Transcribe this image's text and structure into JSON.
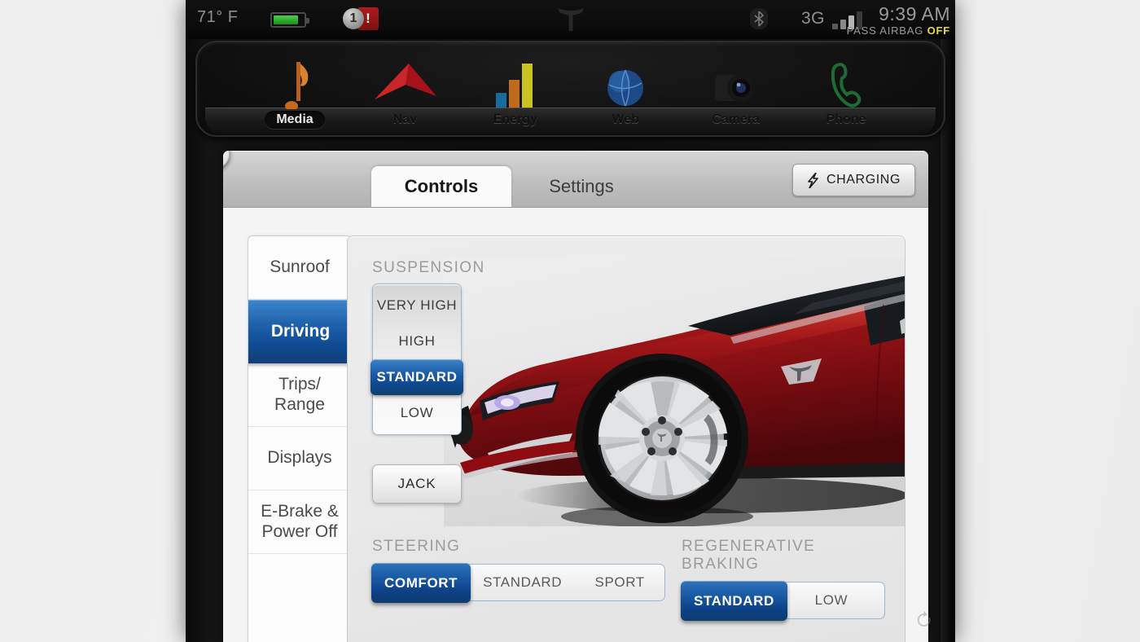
{
  "status_bar": {
    "temperature": "71° F",
    "battery_icon": "battery-icon",
    "warning_count": "1",
    "warning_exclaim": "!",
    "logo_icon": "tesla-logo-icon",
    "bluetooth_icon": "bluetooth-icon",
    "network": "3G",
    "signal_icon": "signal-bars-icon",
    "clock": "9:39 AM",
    "airbag_label": "PASS AIRBAG",
    "airbag_state": "OFF"
  },
  "dock": {
    "items": [
      {
        "label": "Media",
        "icon": "music-note-icon",
        "active": true
      },
      {
        "label": "Nav",
        "icon": "navigation-arrow-icon",
        "active": false
      },
      {
        "label": "Energy",
        "icon": "bar-chart-icon",
        "active": false
      },
      {
        "label": "Web",
        "icon": "globe-icon",
        "active": false
      },
      {
        "label": "Camera",
        "icon": "camera-lens-icon",
        "active": false
      },
      {
        "label": "Phone",
        "icon": "phone-handset-icon",
        "active": false
      }
    ]
  },
  "panel": {
    "close_icon": "close-icon",
    "tabs": [
      {
        "label": "Controls",
        "active": true
      },
      {
        "label": "Settings",
        "active": false
      }
    ],
    "charging_button": {
      "label": "CHARGING",
      "icon": "lightning-bolt-icon"
    }
  },
  "sidebar": {
    "items": [
      {
        "label": "Sunroof",
        "active": false
      },
      {
        "label": "Driving",
        "active": true
      },
      {
        "label": "Trips/\nRange",
        "active": false
      },
      {
        "label": "Displays",
        "active": false
      },
      {
        "label": "E-Brake &\nPower Off",
        "active": false
      }
    ]
  },
  "content": {
    "suspension": {
      "title": "SUSPENSION",
      "options": [
        {
          "label": "VERY HIGH",
          "selected": false
        },
        {
          "label": "HIGH",
          "selected": false
        },
        {
          "label": "STANDARD",
          "selected": true
        },
        {
          "label": "LOW",
          "selected": false
        }
      ],
      "jack_label": "JACK"
    },
    "car_image": {
      "name": "tesla-model-s-red",
      "body_color": "#9e1116",
      "body_highlight": "#cf2a26",
      "glass_color": "#14161a",
      "wheel_color": "#c8cacb"
    },
    "steering": {
      "title": "STEERING",
      "options": [
        {
          "label": "COMFORT",
          "selected": true
        },
        {
          "label": "STANDARD",
          "selected": false
        },
        {
          "label": "SPORT",
          "selected": false
        }
      ]
    },
    "regen_braking": {
      "title": "REGENERATIVE BRAKING",
      "options": [
        {
          "label": "STANDARD",
          "selected": true
        },
        {
          "label": "LOW",
          "selected": false
        }
      ]
    }
  },
  "bezel": {
    "rotate_icon": "rotate-icon"
  },
  "colors": {
    "accent_blue": "#1a5ca5",
    "accent_blue_light": "#3f86cc",
    "accent_blue_dark": "#0f3b6d",
    "airbag_yellow": "#e8d84a",
    "warning_red": "#b01a1a",
    "battery_green": "#4ad24a"
  }
}
